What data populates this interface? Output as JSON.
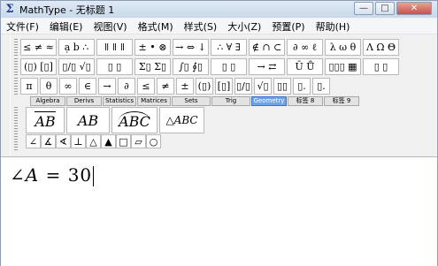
{
  "window": {
    "app_icon": "Σ",
    "title": "MathType - 无标题 1",
    "buttons": [
      "—",
      "□",
      "✕"
    ]
  },
  "menu": {
    "items": [
      "文件(F)",
      "编辑(E)",
      "视图(V)",
      "格式(M)",
      "样式(S)",
      "大小(Z)",
      "预置(P)",
      "帮助(H)"
    ]
  },
  "palette_row1": [
    "≤ ≠ ≈",
    "ạ b ∴",
    "ǁ ǁ ǁ",
    "± • ⊗",
    "→ ⇔ ↓",
    "∴ ∀ ∃",
    "∉ ∩ ⊂",
    "∂ ∞ ℓ",
    "λ ω θ",
    "Λ Ω Θ"
  ],
  "palette_row2": [
    "(▯) [▯]",
    "▯/▯ √▯",
    "▯ ▯",
    "Σ▯ Σ▯",
    "∫▯ ∮▯",
    "▯ ▯",
    "→ ⇄",
    "Ū Ů",
    "▯▯▯ ▦",
    "▯ ▯"
  ],
  "palette_row3": [
    "π",
    "θ",
    "∞",
    "∈",
    "→",
    "∂",
    "≤",
    "≠",
    "±",
    "(▯)",
    "[▯]",
    "▯/▯",
    "√▯",
    "▯▯",
    "▯.",
    "▯."
  ],
  "tabs": [
    "Algebra",
    "Derivs",
    "Statistics",
    "Matrices",
    "Sets",
    "Trig",
    "Geometry",
    "标签 8",
    "标签 9"
  ],
  "active_tab": "Geometry",
  "templates": [
    "AB",
    "AB",
    "ABC",
    "△ABC"
  ],
  "geometry_row": [
    "∠",
    "∡",
    "∢",
    "⊥",
    "△",
    "▲",
    "□",
    "▱",
    "○"
  ],
  "editor": {
    "angle_symbol": "∠",
    "variable": "A",
    "equals": "=",
    "value": "30"
  }
}
